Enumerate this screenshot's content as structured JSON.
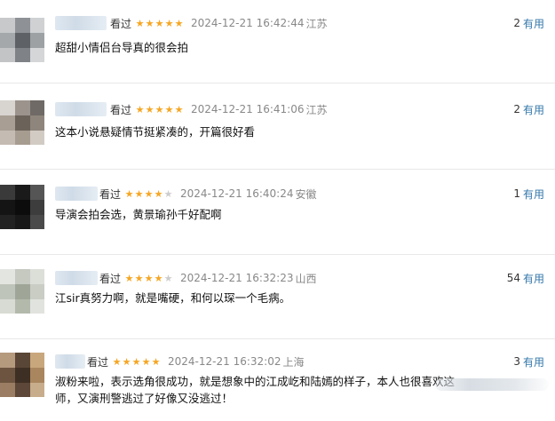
{
  "colors": {
    "star_on": "#f5a623",
    "star_off": "#cccccc",
    "useful_link": "#3377aa",
    "meta_gray": "#888888"
  },
  "icons": {
    "star": "star-icon"
  },
  "comments": [
    {
      "watched": "看过",
      "rating": 5,
      "time": "2024-12-21 16:42:44",
      "location": "江苏",
      "votes": "2",
      "useful": "有用",
      "text": "超甜小情侣台导真的很会拍"
    },
    {
      "watched": "看过",
      "rating": 5,
      "time": "2024-12-21 16:41:06",
      "location": "江苏",
      "votes": "2",
      "useful": "有用",
      "text": "这本小说悬疑情节挺紧凑的，开篇很好看"
    },
    {
      "watched": "看过",
      "rating": 4,
      "time": "2024-12-21 16:40:24",
      "location": "安徽",
      "votes": "1",
      "useful": "有用",
      "text": "导演会拍会选，黄景瑜孙千好配啊"
    },
    {
      "watched": "看过",
      "rating": 4,
      "time": "2024-12-21 16:32:23",
      "location": "山西",
      "votes": "54",
      "useful": "有用",
      "text": "江sir真努力啊，就是嘴硬，和何以琛一个毛病。"
    },
    {
      "watched": "看过",
      "rating": 5,
      "time": "2024-12-21 16:32:02",
      "location": "上海",
      "votes": "3",
      "useful": "有用",
      "text": "淑粉来啦，表示选角很成功，就是想象中的江成屹和陆嫣的样子，本人也很喜欢这",
      "text2": "师，又演刑警逃过了好像又没逃过！"
    }
  ]
}
